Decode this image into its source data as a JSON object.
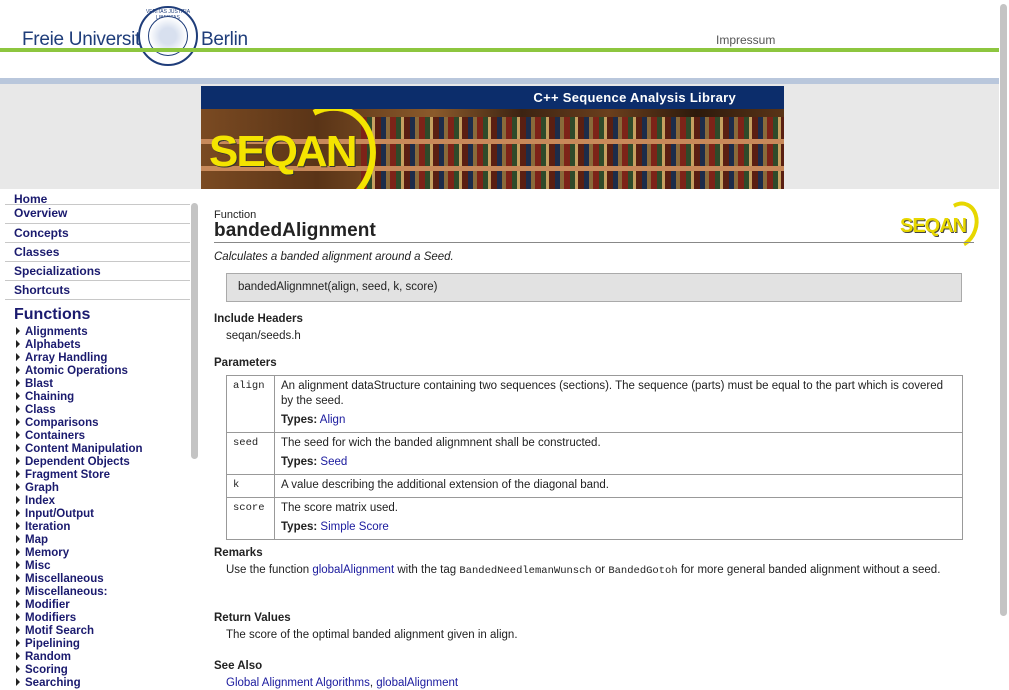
{
  "header": {
    "logo_left": "Freie Universität",
    "logo_right": "Berlin",
    "seal_text": "VERITAS JUSTITIA LIBERTAS",
    "impressum": "Impressum",
    "colors": {
      "brand": "#1f3d7a",
      "green_rule": "#8dc63f",
      "blue_rule": "#b9c7dc"
    }
  },
  "banner": {
    "title": "C++ Sequence Analysis Library",
    "logo_text": "SEQAN"
  },
  "sidebar": {
    "nav": [
      {
        "label": "Home"
      },
      {
        "label": "Overview"
      },
      {
        "label": "Concepts"
      },
      {
        "label": "Classes"
      },
      {
        "label": "Specializations"
      },
      {
        "label": "Shortcuts"
      }
    ],
    "functions_title": "Functions",
    "functions": [
      "Alignments",
      "Alphabets",
      "Array Handling",
      "Atomic Operations",
      "Blast",
      "Chaining",
      "Class",
      "Comparisons",
      "Containers",
      "Content Manipulation",
      "Dependent Objects",
      "Fragment Store",
      "Graph",
      "Index",
      "Input/Output",
      "Iteration",
      "Map",
      "Memory",
      "Misc",
      "Miscellaneous",
      "Miscellaneous:",
      "Modifier",
      "Modifiers",
      "Motif Search",
      "Pipelining",
      "Random",
      "Scoring",
      "Searching"
    ]
  },
  "main": {
    "kind": "Function",
    "title": "bandedAlignment",
    "logo_text": "SEQAN",
    "summary": "Calculates a banded alignment around a Seed.",
    "signature": "bandedAlignmnet(align, seed, k, score)",
    "include_heading": "Include Headers",
    "include_value": "seqan/seeds.h",
    "params_heading": "Parameters",
    "types_label": "Types:",
    "params": [
      {
        "name": "align",
        "desc": "An alignment dataStructure containing two sequences (sections). The sequence (parts) must be equal to the part which is covered by the seed.",
        "type": "Align"
      },
      {
        "name": "seed",
        "desc": "The seed for wich the banded alignmnent shall be constructed.",
        "type": "Seed"
      },
      {
        "name": "k",
        "desc": "A value describing the additional extension of the diagonal band.",
        "type": ""
      },
      {
        "name": "score",
        "desc": "The score matrix used.",
        "type": "Simple Score"
      }
    ],
    "remarks_heading": "Remarks",
    "remarks": {
      "t1": "Use the function ",
      "link1": "globalAlignment",
      "t2": " with the tag ",
      "code1": "BandedNeedlemanWunsch",
      "t3": " or ",
      "code2": "BandedGotoh",
      "t4": " for more general banded alignment without a seed."
    },
    "return_heading": "Return Values",
    "return_text": "The score of the optimal banded alignment given in align.",
    "see_also_heading": "See Also",
    "see_also": [
      "Global Alignment Algorithms",
      "globalAlignment"
    ],
    "see_also_sep": ", "
  }
}
